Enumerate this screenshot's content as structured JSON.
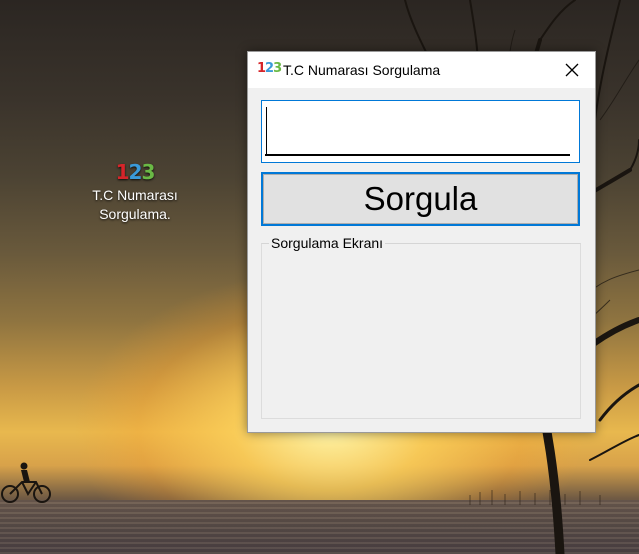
{
  "desktop": {
    "icon": {
      "glyph": [
        "1",
        "2",
        "3"
      ],
      "label_line1": "T.C Numarası",
      "label_line2": "Sorgulama."
    }
  },
  "window": {
    "title": "T.C Numarası Sorgulama",
    "app_icon_glyph": [
      "1",
      "2",
      "3"
    ],
    "close_icon": "close-icon",
    "input": {
      "value": "",
      "placeholder": ""
    },
    "query_button_label": "Sorgula",
    "result_group_label": "Sorgulama Ekranı"
  },
  "colors": {
    "accent": "#0078d7",
    "window_bg": "#f0f0f0",
    "button_bg": "#e1e1e1",
    "icon_digit_1": "#d6252a",
    "icon_digit_2": "#3a9ad9",
    "icon_digit_3": "#6ab945"
  }
}
